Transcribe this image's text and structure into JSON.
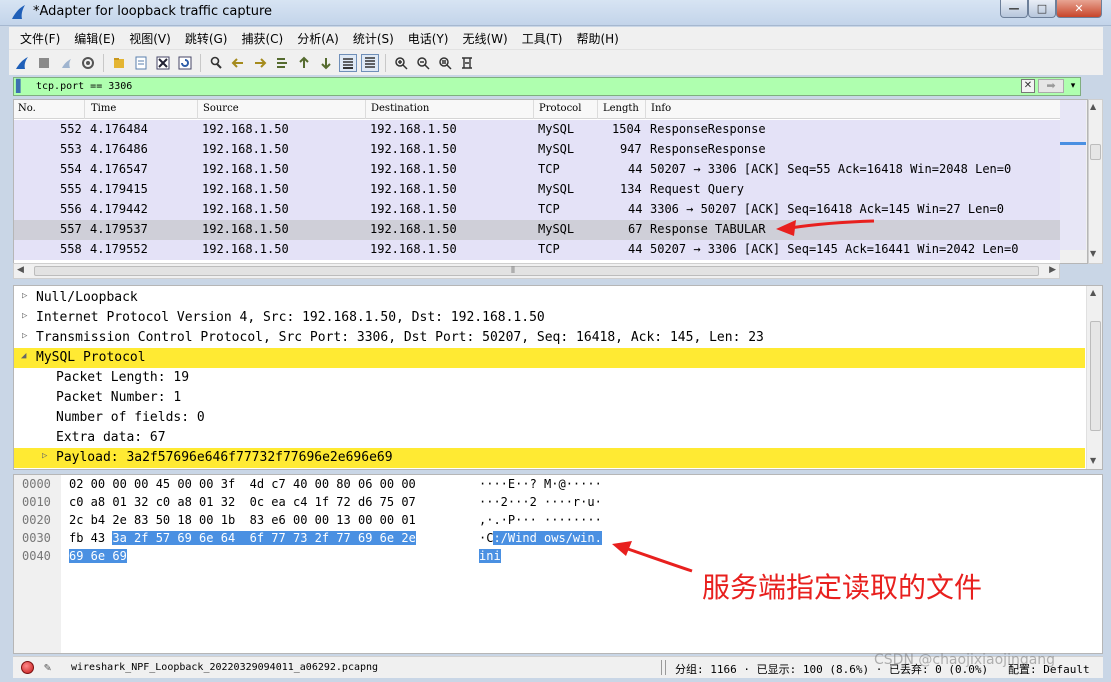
{
  "window": {
    "title": "*Adapter for loopback traffic capture",
    "controls": {
      "minimize": "—",
      "maximize": "□",
      "close": "✕"
    }
  },
  "menu": [
    "文件(F)",
    "编辑(E)",
    "视图(V)",
    "跳转(G)",
    "捕获(C)",
    "分析(A)",
    "统计(S)",
    "电话(Y)",
    "无线(W)",
    "工具(T)",
    "帮助(H)"
  ],
  "filter": {
    "value": "tcp.port == 3306",
    "clear": "✕",
    "apply": "➡",
    "dropdown": "▾"
  },
  "packet_list": {
    "columns": [
      "No.",
      "Time",
      "Source",
      "Destination",
      "Protocol",
      "Length",
      "Info"
    ],
    "rows": [
      {
        "no": "552",
        "time": "4.176484",
        "src": "192.168.1.50",
        "dst": "192.168.1.50",
        "proto": "MySQL",
        "len": "1504",
        "info": "ResponseResponse"
      },
      {
        "no": "553",
        "time": "4.176486",
        "src": "192.168.1.50",
        "dst": "192.168.1.50",
        "proto": "MySQL",
        "len": "947",
        "info": "ResponseResponse"
      },
      {
        "no": "554",
        "time": "4.176547",
        "src": "192.168.1.50",
        "dst": "192.168.1.50",
        "proto": "TCP",
        "len": "44",
        "info": "50207 → 3306 [ACK] Seq=55 Ack=16418 Win=2048 Len=0"
      },
      {
        "no": "555",
        "time": "4.179415",
        "src": "192.168.1.50",
        "dst": "192.168.1.50",
        "proto": "MySQL",
        "len": "134",
        "info": "Request Query"
      },
      {
        "no": "556",
        "time": "4.179442",
        "src": "192.168.1.50",
        "dst": "192.168.1.50",
        "proto": "TCP",
        "len": "44",
        "info": "3306 → 50207 [ACK] Seq=16418 Ack=145 Win=27 Len=0"
      },
      {
        "no": "557",
        "time": "4.179537",
        "src": "192.168.1.50",
        "dst": "192.168.1.50",
        "proto": "MySQL",
        "len": "67",
        "info": "Response TABULAR"
      },
      {
        "no": "558",
        "time": "4.179552",
        "src": "192.168.1.50",
        "dst": "192.168.1.50",
        "proto": "TCP",
        "len": "44",
        "info": "50207 → 3306 [ACK] Seq=145 Ack=16441 Win=2042 Len=0"
      }
    ]
  },
  "details": [
    {
      "text": "Null/Loopback",
      "arrow": "▷",
      "indent": 0
    },
    {
      "text": "Internet Protocol Version 4, Src: 192.168.1.50, Dst: 192.168.1.50",
      "arrow": "▷",
      "indent": 0
    },
    {
      "text": "Transmission Control Protocol, Src Port: 3306, Dst Port: 50207, Seq: 16418, Ack: 145, Len: 23",
      "arrow": "▷",
      "indent": 0
    },
    {
      "text": "MySQL Protocol",
      "arrow": "◢",
      "indent": 0,
      "highlight": true
    },
    {
      "text": "Packet Length: 19",
      "arrow": "",
      "indent": 1
    },
    {
      "text": "Packet Number: 1",
      "arrow": "",
      "indent": 1
    },
    {
      "text": "Number of fields: 0",
      "arrow": "",
      "indent": 1
    },
    {
      "text": "Extra data: 67",
      "arrow": "",
      "indent": 1
    },
    {
      "text": "Payload: 3a2f57696e646f77732f77696e2e696e69",
      "arrow": "▷",
      "indent": 1,
      "highlight": true
    }
  ],
  "bytes": [
    {
      "offset": "0000",
      "hex_plain": "02 00 00 00 45 00 00 3f  4d c7 40 00 80 06 00 00",
      "hex_hl": "",
      "ascii_plain": "····E··? M·@·····",
      "ascii_hl": ""
    },
    {
      "offset": "0010",
      "hex_plain": "c0 a8 01 32 c0 a8 01 32  0c ea c4 1f 72 d6 75 07",
      "hex_hl": "",
      "ascii_plain": "···2···2 ····r·u·",
      "ascii_hl": ""
    },
    {
      "offset": "0020",
      "hex_plain": "2c b4 2e 83 50 18 00 1b  83 e6 00 00 13 00 00 01",
      "hex_hl": "",
      "ascii_plain": ",·.·P··· ········",
      "ascii_hl": ""
    },
    {
      "offset": "0030",
      "hex_plain": "fb 43 ",
      "hex_hl": "3a 2f 57 69 6e 64  6f 77 73 2f 77 69 6e 2e",
      "ascii_plain": "·C",
      "ascii_hl": ":/Wind ows/win."
    },
    {
      "offset": "0040",
      "hex_plain": "",
      "hex_hl": "69 6e 69",
      "ascii_plain": "",
      "ascii_hl": "ini"
    }
  ],
  "annotation": "服务端指定读取的文件",
  "status": {
    "file": "wireshark_NPF_Loopback_20220329094011_a06292.pcapng",
    "stats": "分组: 1166 · 已显示: 100 (8.6%) · 已丢弃: 0 (0.0%)   配置: Default"
  },
  "watermark": "CSDN @chaojixiaojingang",
  "colors": {
    "accent_row": "#e4e2f7",
    "selected_row": "#cfcfd8",
    "highlight": "#ffea33",
    "filter_ok": "#afffaf",
    "byte_select": "#4a90e2",
    "annotation": "#e8201e"
  }
}
